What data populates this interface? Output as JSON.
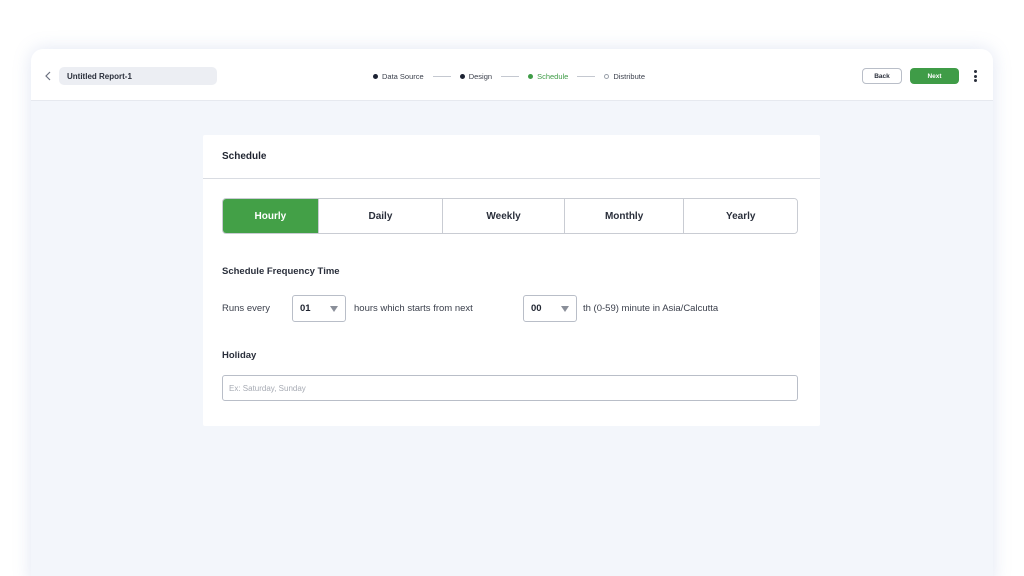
{
  "header": {
    "report_name": "Untitled Report-1",
    "back_label": "Back",
    "next_label": "Next",
    "back_icon": "chevron-left-icon",
    "more_icon": "kebab-menu-icon"
  },
  "stepper": {
    "steps": [
      {
        "label": "Data Source",
        "state": "done"
      },
      {
        "label": "Design",
        "state": "done"
      },
      {
        "label": "Schedule",
        "state": "active"
      },
      {
        "label": "Distribute",
        "state": "todo"
      }
    ]
  },
  "schedule": {
    "title": "Schedule",
    "tabs": [
      "Hourly",
      "Daily",
      "Weekly",
      "Monthly",
      "Yearly"
    ],
    "active_tab": "Hourly",
    "frequency_title": "Schedule Frequency Time",
    "runs_every_label": "Runs every",
    "hours_value": "01",
    "hours_text": "hours which starts from next",
    "minute_value": "00",
    "minute_text": "th (0-59) minute in Asia/Calcutta"
  },
  "holiday": {
    "title": "Holiday",
    "placeholder": "Ex: Saturday, Sunday"
  },
  "colors": {
    "accent": "#43a047",
    "background": "#f3f6fb"
  }
}
